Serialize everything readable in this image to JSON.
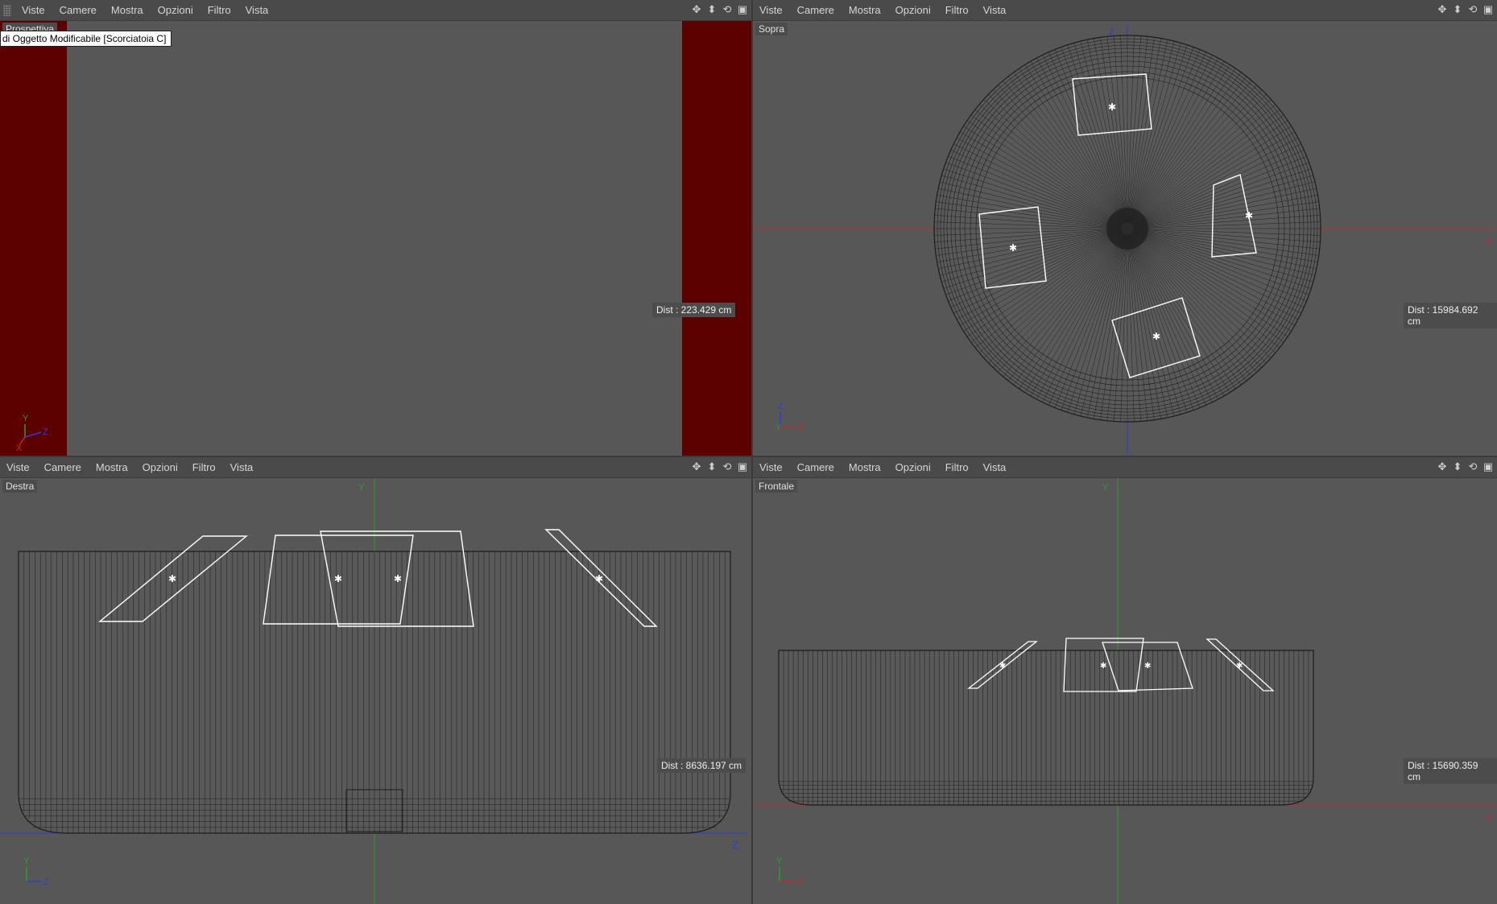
{
  "menus": [
    "Viste",
    "Camere",
    "Mostra",
    "Opzioni",
    "Filtro",
    "Vista"
  ],
  "tool_icons": [
    "move-icon",
    "zoom-icon",
    "rotate-icon",
    "maximize-icon"
  ],
  "viewports": {
    "top_left": {
      "label": "Prospettiva",
      "tooltip": "di Oggetto Modificabile [Scorciatoia C]",
      "dist": "Dist : 223.429 cm",
      "axis": {
        "y": "Y",
        "z": "Z",
        "x": "X"
      }
    },
    "top_right": {
      "label": "Sopra",
      "dist": "Dist : 15984.692 cm",
      "axis": {
        "z": "Z",
        "y": "Y",
        "x": "X"
      },
      "world_axis": {
        "z": "Z",
        "x": "X"
      }
    },
    "bottom_left": {
      "label": "Destra",
      "dist": "Dist : 8636.197 cm",
      "axis": {
        "y": "Y",
        "z": "Z"
      },
      "world_axis": {
        "y": "Y",
        "z": "Z"
      }
    },
    "bottom_right": {
      "label": "Frontale",
      "dist": "Dist : 15690.359 cm",
      "axis": {
        "y": "Y",
        "x": "X"
      },
      "world_axis": {
        "y": "Y",
        "x": "X"
      }
    }
  },
  "colors": {
    "viewport_bg": "#575757",
    "menubar_bg": "#4a4a4a",
    "wire": "#1c1c1c",
    "selected_wire": "#ffffff",
    "dark_red": "#5c0000",
    "axis_x": "#c62828",
    "axis_y": "#2e9e2e",
    "axis_z": "#2a3fd6"
  }
}
